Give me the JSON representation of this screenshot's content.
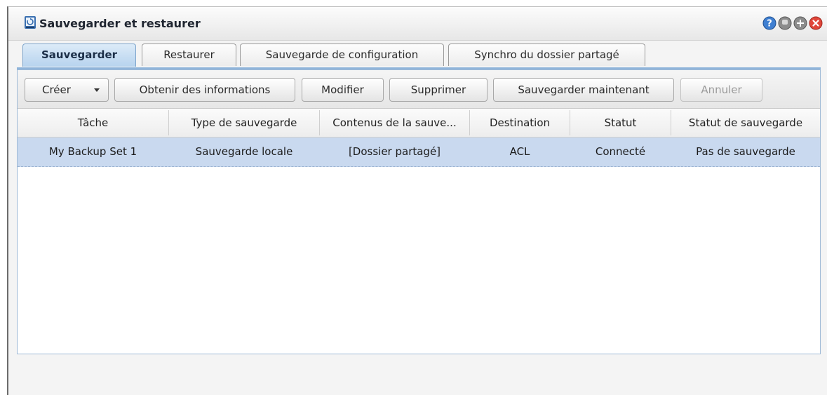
{
  "window": {
    "title": "Sauvegarder et restaurer",
    "controls": [
      "help-icon",
      "minimize-icon",
      "maximize-icon",
      "close-icon"
    ]
  },
  "tabs": [
    {
      "label": "Sauvegarder",
      "active": true
    },
    {
      "label": "Restaurer",
      "active": false
    },
    {
      "label": "Sauvegarde de configuration",
      "active": false
    },
    {
      "label": "Synchro du dossier partagé",
      "active": false
    }
  ],
  "toolbar": {
    "create_label": "Créer",
    "info_label": "Obtenir des informations",
    "modify_label": "Modifier",
    "delete_label": "Supprimer",
    "backup_now_label": "Sauvegarder maintenant",
    "cancel_label": "Annuler"
  },
  "table": {
    "columns": [
      "Tâche",
      "Type de sauvegarde",
      "Contenus de la sauve...",
      "Destination",
      "Statut",
      "Statut de sauvegarde"
    ],
    "rows": [
      [
        "My Backup Set 1",
        "Sauvegarde locale",
        "[Dossier partagé]",
        "ACL",
        "Connecté",
        "Pas de sauvegarde"
      ]
    ]
  },
  "colors": {
    "accent": "#8fb4da",
    "selected_row": "#c9d9ef",
    "close_button": "#e0463a"
  }
}
